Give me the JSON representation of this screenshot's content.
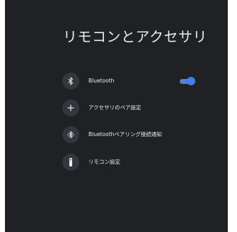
{
  "page": {
    "title": "リモコンとアクセサリ"
  },
  "settings": [
    {
      "label": "Bluetooth",
      "icon": "bluetooth-icon",
      "toggle": {
        "on": true
      }
    },
    {
      "label": "アクセサリのペア設定",
      "icon": "plus-icon"
    },
    {
      "label": "Bluetoothペアリング接続通知",
      "icon": "bluetooth-connect-icon"
    },
    {
      "label": "リモコン設定",
      "icon": "remote-icon"
    }
  ],
  "colors": {
    "background": "#202124",
    "text": "#e8eaed",
    "icon_circle": "#33373b",
    "toggle_accent": "#3b7ff2"
  }
}
